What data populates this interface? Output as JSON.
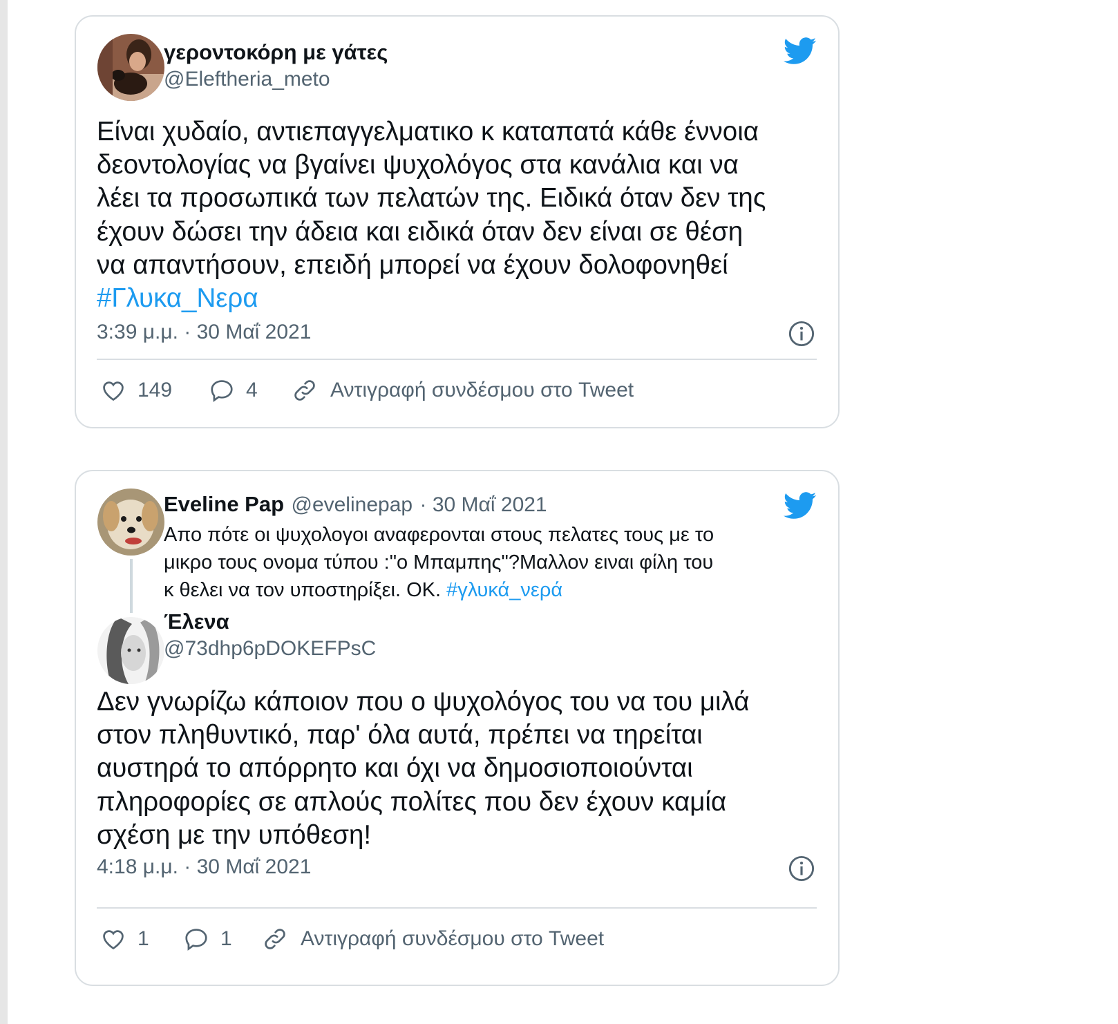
{
  "colors": {
    "accent": "#1d9bf0",
    "secondary_text": "#536471",
    "border": "#d9dee2"
  },
  "tweet1": {
    "author_name": "γεροντοκόρη με γάτες",
    "author_handle": "@Eleftheria_meto",
    "text_lines": [
      "Είναι χυδαίο, αντιεπαγγελματικο κ καταπατά κάθε έννοια",
      "δεοντολογίας να βγαίνει ψυχολόγος στα κανάλια και να",
      "λέει τα προσωπικά των πελατών της. Ειδικά όταν δεν της",
      "έχουν δώσει την άδεια και ειδικά όταν δεν είναι σε θέση",
      "να απαντήσουν, επειδή μπορεί να έχουν δολοφονηθεί"
    ],
    "hashtag": "#Γλυκα_Νερα",
    "timestamp": "3:39 μ.μ. · 30 Μαΐ 2021",
    "likes": "149",
    "replies": "4",
    "copy_link_label": "Αντιγραφή συνδέσμου στο Tweet"
  },
  "tweet2": {
    "quoted": {
      "author_name": "Eveline Pap",
      "author_handle": "@evelinepap",
      "date": "· 30 Μαΐ 2021",
      "text_lines": [
        "Απο πότε οι ψυχολογοι  αναφερονται στους πελατες τους με το",
        "μικρο τους ονομα τύπου :\"ο Μπαμπης\"?Μαλλον ειναι φίλη του"
      ],
      "last_line": "κ θελει να τον υποστηρίξει. ΟΚ.",
      "hashtag": "#γλυκά_νερά"
    },
    "author_name": "Έλενα",
    "author_handle": "@73dhp6pDOKEFPsC",
    "text_lines": [
      "Δεν γνωρίζω κάποιον που ο ψυχολόγος του να του μιλά",
      "στον πληθυντικό, παρ' όλα αυτά, πρέπει να τηρείται",
      "αυστηρά το απόρρητο και όχι να δημοσιοποιούνται",
      "πληροφορίες σε απλούς πολίτες που δεν έχουν καμία",
      "σχέση με την υπόθεση!"
    ],
    "timestamp": "4:18 μ.μ. · 30 Μαΐ 2021",
    "likes": "1",
    "replies": "1",
    "copy_link_label": "Αντιγραφή συνδέσμου στο Tweet"
  },
  "icons": {
    "brand": "twitter-bird-icon",
    "info": "info-icon",
    "like": "heart-icon",
    "reply": "speech-bubble-icon",
    "link": "link-icon"
  }
}
